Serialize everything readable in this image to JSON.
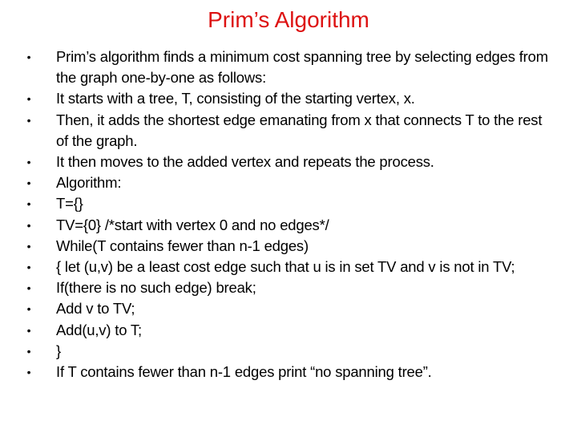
{
  "slide": {
    "title": "Prim’s Algorithm",
    "title_color": "#dd1111",
    "bullet_glyph": "•",
    "bullets": [
      "Prim’s algorithm finds a minimum cost spanning tree by selecting edges from the graph one-by-one as follows:",
      "It starts with a tree, T, consisting of the starting vertex, x.",
      "Then, it adds the shortest edge emanating from x that connects T to the rest of the graph.",
      "It then moves to the added vertex and repeats the process.",
      "Algorithm:",
      "T={}",
      "TV={0} /*start with vertex 0 and no edges*/",
      "While(T contains fewer than n-1 edges)",
      "{ let (u,v) be a least cost edge such that u is in set TV and v is not in TV;",
      "If(there is no such edge) break;",
      "Add v to TV;",
      "Add(u,v) to T;",
      "}",
      "If T contains fewer than n-1 edges print “no spanning tree”."
    ]
  }
}
